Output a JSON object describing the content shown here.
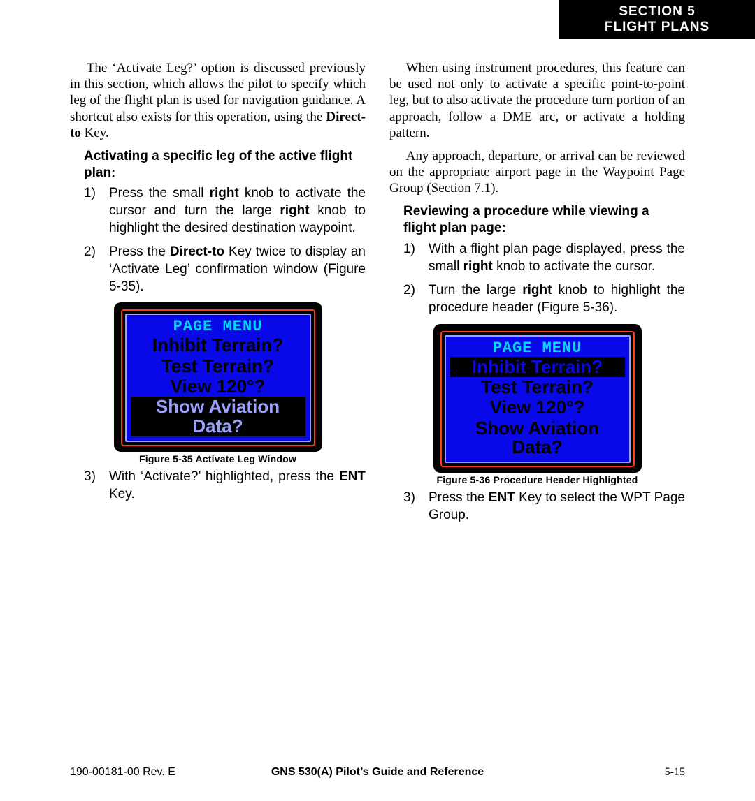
{
  "header": {
    "line1": "SECTION 5",
    "line2": "FLIGHT PLANS"
  },
  "left": {
    "p1a": "The ‘Activate Leg?’ option is discussed previously in this section, which allows the pilot to specify which leg of the flight plan is used for navigation guidance.  A shortcut also exists for this operation, using the ",
    "p1b": "Direct-to",
    "p1c": " Key.",
    "h1": "Activating a specific leg of the active flight plan:",
    "s1a": "Press the small ",
    "s1b": "right",
    "s1c": " knob to activate the cursor and turn the large ",
    "s1d": "right",
    "s1e": " knob to highlight the desired destination waypoint.",
    "s2a": "Press the ",
    "s2b": "Direct-to",
    "s2c": " Key twice to display an ‘Activate Leg’ confirmation window (Figure 5-35).",
    "figcap": "Figure 5-35  Activate Leg Window",
    "s3a": "With ‘Activate?’ highlighted, press the ",
    "s3b": "ENT",
    "s3c": " Key.",
    "menu": {
      "title": "PAGE MENU",
      "i1": "Inhibit Terrain?",
      "i2": "Test Terrain?",
      "i3": "View 120°?",
      "i4": "Show Aviation Data?"
    }
  },
  "right": {
    "p1": "When using instrument procedures, this feature can be used not only to activate a specific point-to-point leg, but to also activate the procedure turn portion of an approach, follow a DME arc, or activate a holding pattern.",
    "p2": "Any approach, departure, or arrival can be reviewed on the appropriate airport page in the Waypoint Page Group (Section 7.1).",
    "h1": "Reviewing a procedure while viewing a flight plan page:",
    "s1a": "With a flight plan page displayed, press the small ",
    "s1b": "right",
    "s1c": " knob to activate the cursor.",
    "s2a": "Turn the large ",
    "s2b": "right",
    "s2c": " knob to highlight the procedure header (Figure 5-36).",
    "figcap": "Figure 5-36  Procedure Header Highlighted",
    "s3a": "Press the ",
    "s3b": "ENT",
    "s3c": " Key to select the WPT Page Group.",
    "menu": {
      "title": "PAGE MENU",
      "i1": "Inhibit Terrain?",
      "i2": "Test Terrain?",
      "i3": "View 120°?",
      "i4": "Show Aviation Data?"
    }
  },
  "footer": {
    "left": "190-00181-00  Rev. E",
    "mid": "GNS 530(A) Pilot’s Guide and Reference",
    "right": "5-15"
  }
}
